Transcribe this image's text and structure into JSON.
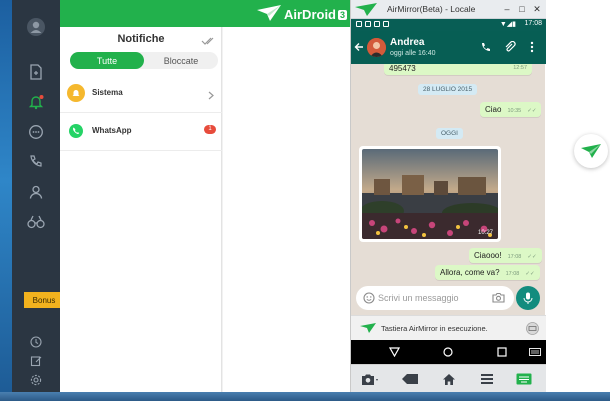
{
  "airdroid": {
    "brand": "AirDroid",
    "version_badge": "3",
    "bonus_label": "Bonus",
    "sidebar_icons": [
      "avatar-icon",
      "file-transfer-icon",
      "notification-bell-icon",
      "message-icon",
      "call-icon",
      "contacts-icon",
      "find-phone-icon",
      "help-icon",
      "edit-icon",
      "settings-icon"
    ],
    "accent": "#22b14c"
  },
  "notifications": {
    "title": "Notifiche",
    "tabs": [
      {
        "label": "Tutte",
        "active": true
      },
      {
        "label": "Bloccate",
        "active": false
      }
    ],
    "items": [
      {
        "label": "Sistema",
        "icon": "bell-icon",
        "badge": ""
      },
      {
        "label": "WhatsApp",
        "icon": "whatsapp-icon",
        "badge": "1"
      }
    ]
  },
  "airmirror": {
    "title": "AirMirror(Beta) - Locale",
    "status_time": "17:08",
    "contact": {
      "name": "Andrea",
      "last_seen": "oggi alle 16:40"
    },
    "messages": {
      "partial_text": "495473",
      "partial_time": "12:57",
      "date_divider": "28 LUGLIO 2015",
      "ciao_text": "Ciao",
      "ciao_time": "10:35",
      "today_divider": "OGGI",
      "photo_time": "10:27",
      "ciaooo_text": "Ciaooo!",
      "ciaooo_time": "17:08",
      "allora_text": "Allora, come va?",
      "allora_time": "17:08"
    },
    "input_placeholder": "Scrivi un messaggio",
    "keyboard_notice": "Tastiera AirMirror in esecuzione.",
    "wa_color": "#075e54"
  }
}
